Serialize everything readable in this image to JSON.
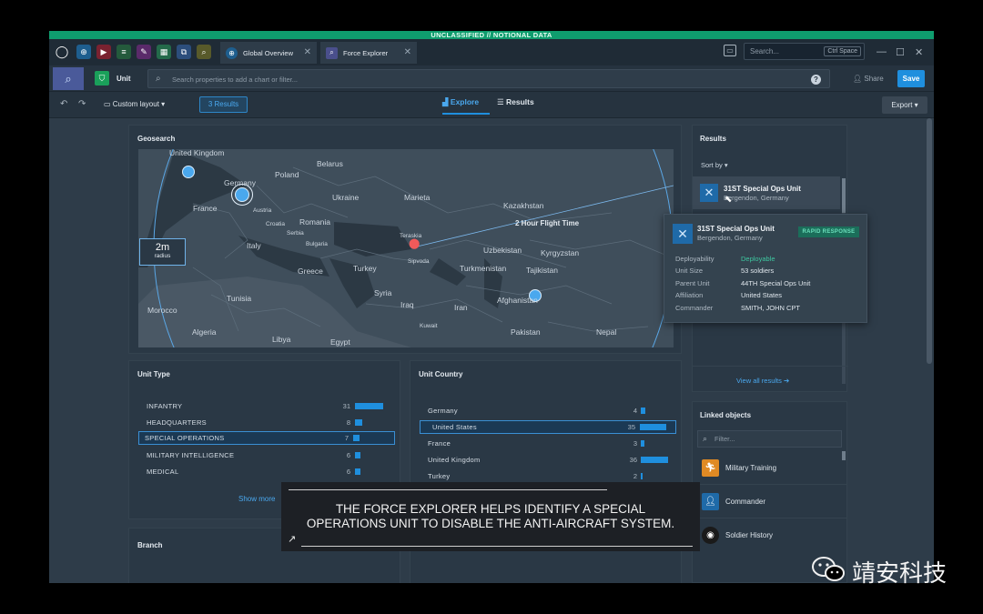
{
  "classification": "UNCLASSIFIED // NOTIONAL DATA",
  "tabs": [
    {
      "label": "Global Overview"
    },
    {
      "label": "Force Explorer"
    }
  ],
  "top_search": {
    "placeholder": "Search...",
    "shortcut": "Ctrl Space"
  },
  "object_bar": {
    "object_type": "Unit",
    "search_placeholder": "Search properties to add a chart or filter...",
    "share_label": "Share",
    "save_label": "Save"
  },
  "toolbar": {
    "layout_label": "Custom layout",
    "results_badge": "3 Results",
    "explore_label": "Explore",
    "results_label": "Results",
    "export_label": "Export"
  },
  "geosearch": {
    "title": "Geosearch",
    "radius_value": "2m",
    "radius_label": "radius",
    "flight_label": "2 Hour Flight Time",
    "places": [
      "United Kingdom",
      "Germany",
      "France",
      "Austria",
      "Croatia",
      "Serbia",
      "Bulgaria",
      "Italy",
      "Poland",
      "Belarus",
      "Ukraine",
      "Romania",
      "Greece",
      "Turkey",
      "Marieta",
      "Kazakhstan",
      "Teraskia",
      "Sipvoda",
      "Uzbekistan",
      "Kyrgyzstan",
      "Turkmenistan",
      "Tajikistan",
      "Afghanistan",
      "Tunisia",
      "Morocco",
      "Algeria",
      "Libya",
      "Egypt",
      "Syria",
      "Iraq",
      "Iran",
      "Kuwait",
      "Pakistan",
      "Nepal"
    ]
  },
  "unit_type": {
    "title": "Unit Type",
    "rows": [
      {
        "label": "INFANTRY",
        "count": 31
      },
      {
        "label": "HEADQUARTERS",
        "count": 8
      },
      {
        "label": "SPECIAL OPERATIONS",
        "count": 7
      },
      {
        "label": "MILITARY INTELLIGENCE",
        "count": 6
      },
      {
        "label": "MEDICAL",
        "count": 6
      }
    ],
    "show_more": "Show more"
  },
  "unit_country": {
    "title": "Unit Country",
    "rows": [
      {
        "label": "Germany",
        "count": 4
      },
      {
        "label": "United States",
        "count": 35
      },
      {
        "label": "France",
        "count": 3
      },
      {
        "label": "United Kingdom",
        "count": 36
      },
      {
        "label": "Turkey",
        "count": 2
      }
    ]
  },
  "branch": {
    "title": "Branch"
  },
  "results": {
    "title": "Results",
    "sort_label": "Sort by",
    "item": {
      "name": "31ST Special Ops Unit",
      "location": "Bergendon, Germany"
    },
    "view_all": "View all results"
  },
  "popup": {
    "name": "31ST Special Ops Unit",
    "location": "Bergendon, Germany",
    "badge": "RAPID RESPONSE",
    "attributes": [
      {
        "key": "Deployability",
        "value": "Deployable"
      },
      {
        "key": "Unit Size",
        "value": "53 soldiers"
      },
      {
        "key": "Parent Unit",
        "value": "44TH Special Ops Unit"
      },
      {
        "key": "Affiliation",
        "value": "United States"
      },
      {
        "key": "Commander",
        "value": "SMITH, JOHN CPT"
      }
    ]
  },
  "linked_objects": {
    "title": "Linked objects",
    "filter_placeholder": "Filter...",
    "items": [
      {
        "label": "Military Training",
        "icon": "running-figure-icon"
      },
      {
        "label": "Commander",
        "icon": "person-icon"
      },
      {
        "label": "Soldier History",
        "icon": "helmet-icon"
      }
    ]
  },
  "caption": {
    "line1": "THE FORCE EXPLORER HELPS IDENTIFY A SPECIAL",
    "line2": "OPERATIONS UNIT TO DISABLE THE ANTI-AIRCRAFT SYSTEM."
  },
  "watermark": "靖安科技",
  "colors": {
    "accent": "#1f8fde",
    "classification": "#0f9d6e",
    "deployable": "#3ec7a0",
    "badge": "#1b6e5a"
  }
}
